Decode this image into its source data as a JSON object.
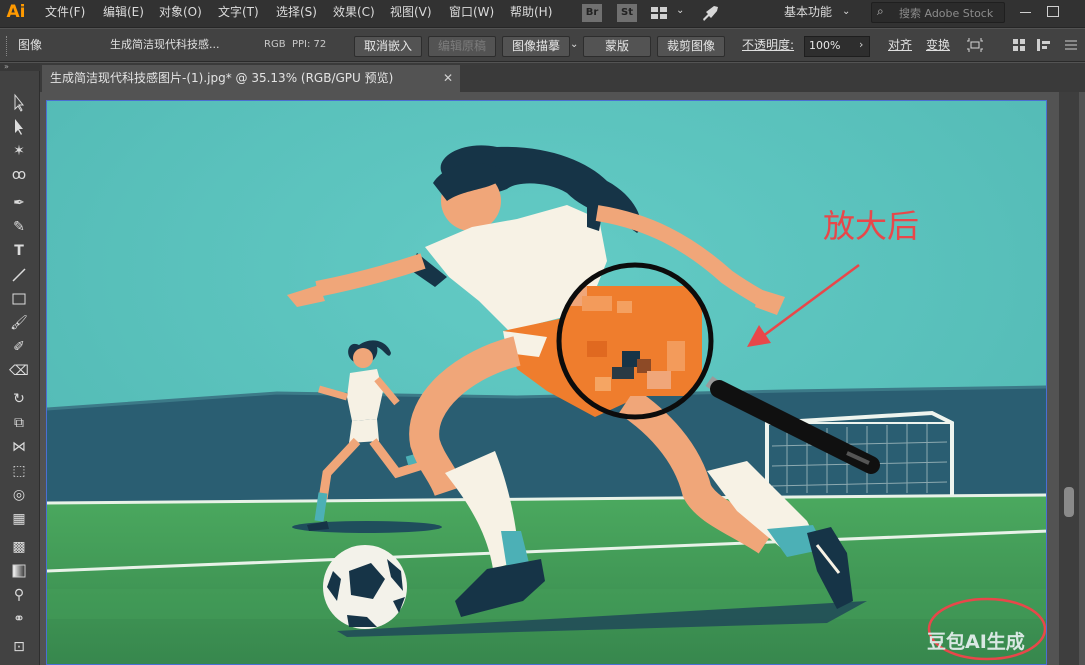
{
  "app": {
    "logo": "Ai",
    "workspace": "基本功能",
    "search_placeholder": "搜索 Adobe Stock"
  },
  "menu": [
    "文件(F)",
    "编辑(E)",
    "对象(O)",
    "文字(T)",
    "选择(S)",
    "效果(C)",
    "视图(V)",
    "窗口(W)",
    "帮助(H)"
  ],
  "app_icons": [
    "Br",
    "St"
  ],
  "control_bar": {
    "type_label": "图像",
    "filename": "生成简洁现代科技感...",
    "color_mode": "RGB",
    "ppi": "PPI: 72",
    "unembed": "取消嵌入",
    "edit_original": "编辑原稿",
    "image_trace": "图像描摹",
    "mask": "蒙版",
    "crop": "裁剪图像",
    "opacity_label": "不透明度:",
    "opacity_value": "100%",
    "align": "对齐",
    "transform": "变换"
  },
  "document": {
    "tab_title": "生成简洁现代科技感图片-(1).jpg* @ 35.13% (RGB/GPU 预览)",
    "close": "✕"
  },
  "artwork": {
    "annotation": "放大后",
    "watermark": "豆包AI生成"
  },
  "colors": {
    "annotation_red": "#e8474a",
    "sky": "#5bc3bd",
    "field": "#3f9a5b",
    "shorts": "#ef7d2d"
  }
}
